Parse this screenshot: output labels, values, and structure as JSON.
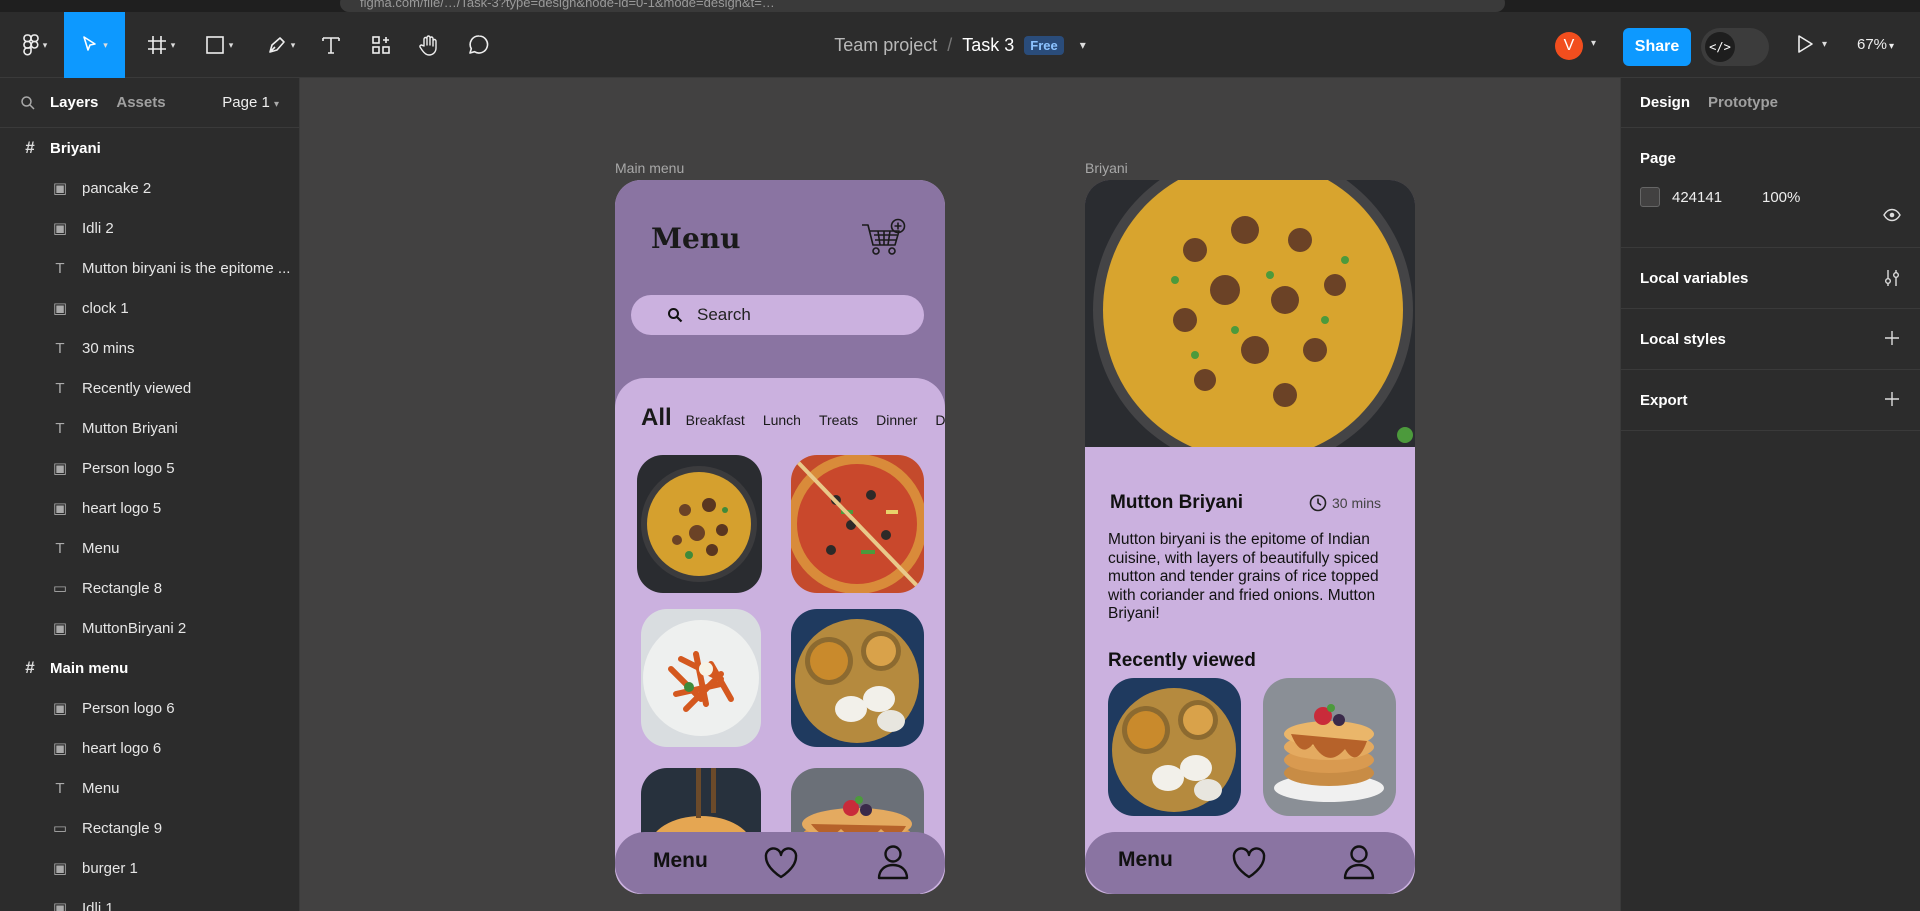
{
  "browser": {
    "url": "figma.com/file/…/Task-3?type=design&node-id=0-1&mode=design&t=…"
  },
  "toolbar": {
    "tools": [
      "figma-menu-icon",
      "move-tool-icon",
      "frame-tool-icon",
      "shape-tool-icon",
      "pen-tool-icon",
      "text-tool-icon",
      "resources-icon",
      "hand-tool-icon",
      "comment-icon"
    ],
    "team": "Team project",
    "separator": "/",
    "file": "Task 3",
    "plan_badge": "Free",
    "avatar_letter": "V",
    "share_label": "Share",
    "dev_mode_label": "</>",
    "zoom": "67%"
  },
  "left_panel": {
    "tabs": {
      "layers": "Layers",
      "assets": "Assets"
    },
    "page_selector": "Page 1",
    "layers": [
      {
        "type": "frame",
        "name": "Briyani"
      },
      {
        "type": "image",
        "name": "pancake 2"
      },
      {
        "type": "image",
        "name": "Idli 2"
      },
      {
        "type": "text",
        "name": "Mutton biryani is the epitome ..."
      },
      {
        "type": "image",
        "name": "clock 1"
      },
      {
        "type": "text",
        "name": "30 mins"
      },
      {
        "type": "text",
        "name": "Recently viewed"
      },
      {
        "type": "text",
        "name": "Mutton Briyani"
      },
      {
        "type": "image",
        "name": "Person logo 5"
      },
      {
        "type": "image",
        "name": "heart logo 5"
      },
      {
        "type": "text",
        "name": "Menu"
      },
      {
        "type": "rect",
        "name": "Rectangle 8"
      },
      {
        "type": "image",
        "name": "MuttonBiryani 2"
      },
      {
        "type": "frame",
        "name": "Main menu"
      },
      {
        "type": "image",
        "name": "Person logo 6"
      },
      {
        "type": "image",
        "name": "heart logo 6"
      },
      {
        "type": "text",
        "name": "Menu"
      },
      {
        "type": "rect",
        "name": "Rectangle 9"
      },
      {
        "type": "image",
        "name": "burger 1"
      },
      {
        "type": "image",
        "name": "Idli 1"
      }
    ]
  },
  "right_panel": {
    "tabs": {
      "design": "Design",
      "prototype": "Prototype"
    },
    "page_heading": "Page",
    "page_color": "424141",
    "page_opacity": "100%",
    "sections": [
      {
        "label": "Local variables",
        "action": "settings-icon"
      },
      {
        "label": "Local styles",
        "action": "plus-icon"
      },
      {
        "label": "Export",
        "action": "plus-icon"
      }
    ]
  },
  "canvas": {
    "main_menu": {
      "frame_label": "Main menu",
      "title": "Menu",
      "search_placeholder": "Search",
      "categories": {
        "all": "All",
        "others": [
          "Breakfast",
          "Lunch",
          "Treats",
          "Dinner",
          "De"
        ]
      },
      "foods": [
        "biryani",
        "pizza",
        "sweet-potato-fries",
        "idli",
        "burger",
        "pancakes"
      ],
      "nav_label": "Menu"
    },
    "briyani": {
      "frame_label": "Briyani",
      "dish": "Mutton Briyani",
      "time": "30 mins",
      "description": "Mutton biryani is the epitome of Indian cuisine, with layers of beautifully spiced mutton and tender grains of rice topped with coriander and fried onions. Mutton Briyani!",
      "recent_heading": "Recently viewed",
      "recent_items": [
        "idli",
        "pancakes"
      ],
      "nav_label": "Menu"
    }
  },
  "colors": {
    "canvas": "#424141",
    "panel": "#2c2c2c",
    "accent": "#0d99ff",
    "phone_dark": "#8a74a2",
    "phone_light": "#cbb1df"
  }
}
